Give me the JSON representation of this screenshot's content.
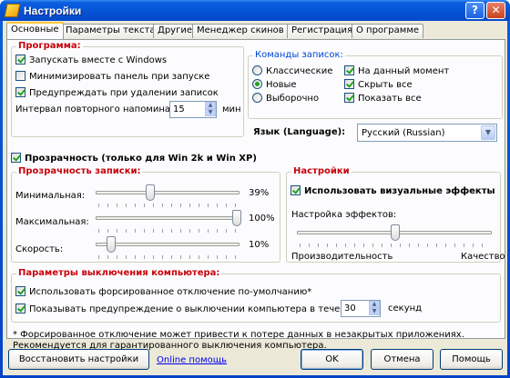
{
  "window": {
    "title": "Настройки",
    "help_label": "?",
    "close_label": "✕"
  },
  "tabs": [
    "Основные",
    "Параметры текста",
    "Другие",
    "Менеджер скинов",
    "Регистрация",
    "О программе"
  ],
  "program": {
    "title": "Программа:",
    "run_with_windows": "Запускать вместе с Windows",
    "minimize_on_start": "Минимизировать панель при запуске",
    "warn_on_delete": "Предупреждать при удалении записок",
    "remind_interval_label": "Интервал повторного напоминания",
    "remind_interval_value": "15",
    "remind_unit": "мин"
  },
  "note_commands": {
    "title": "Команды записок:",
    "radio_classic": "Классические",
    "radio_new": "Новые",
    "radio_custom": "Выборочно",
    "cb_current": "На данный момент",
    "cb_hide_all": "Скрыть все",
    "cb_show_all": "Показать все"
  },
  "language": {
    "label": "Язык (Language):",
    "value": "Русский (Russian)"
  },
  "transparency_toggle": "Прозрачность (только для Win 2k и Win XP)",
  "transparency": {
    "title": "Прозрачность записки:",
    "min_label": "Минимальная:",
    "min_value": "39%",
    "max_label": "Максимальная:",
    "max_value": "100%",
    "speed_label": "Скорость:",
    "speed_value": "10%"
  },
  "settings": {
    "title": "Настройки",
    "visual_effects": "Использовать визуальные эффекты",
    "effects_label": "Настройка эффектов:",
    "left_label": "Производительность",
    "right_label": "Качество"
  },
  "shutdown": {
    "title": "Параметры выключения компьютера:",
    "force_shutdown": "Использовать форсированное отключение по-умолчанию*",
    "show_warning": "Показывать предупреждение о выключении компьютера в течение",
    "seconds_value": "30",
    "seconds_unit": "секунд"
  },
  "footnote": "* Форсированное отключение может привести к потере данных в незакрытых приложениях. Рекомендуется для гарантированного выключения компьютера.",
  "buttons": {
    "restore": "Восстановить настройки",
    "online_help": "Online помощь",
    "ok": "OK",
    "cancel": "Отмена",
    "help": "Помощь"
  }
}
